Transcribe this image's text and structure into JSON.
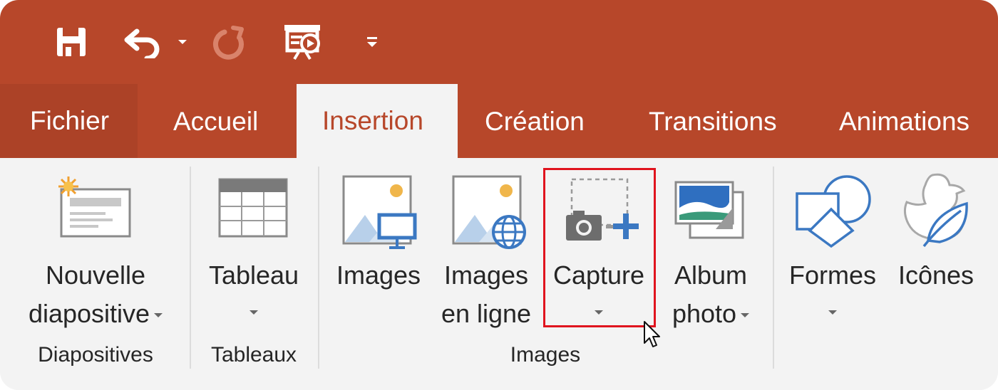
{
  "qat": {
    "save_icon": "save-icon",
    "undo_icon": "undo-icon",
    "redo_icon": "redo-icon",
    "present_icon": "present-from-start-icon",
    "customize_icon": "customize-qat-icon"
  },
  "tabs": [
    {
      "label": "Fichier"
    },
    {
      "label": "Accueil"
    },
    {
      "label": "Insertion"
    },
    {
      "label": "Création"
    },
    {
      "label": "Transitions"
    },
    {
      "label": "Animations"
    }
  ],
  "ribbon": {
    "new_slide": {
      "line1": "Nouvelle",
      "line2": "diapositive"
    },
    "table": {
      "line1": "Tableau"
    },
    "images": {
      "line1": "Images"
    },
    "online_images": {
      "line1": "Images",
      "line2": "en ligne"
    },
    "capture": {
      "line1": "Capture"
    },
    "album": {
      "line1": "Album",
      "line2": "photo"
    },
    "shapes": {
      "line1": "Formes"
    },
    "icons": {
      "line1": "Icônes"
    }
  },
  "groups": {
    "slides": "Diapositives",
    "tables": "Tableaux",
    "images": "Images"
  },
  "colors": {
    "brand": "#b7472a",
    "highlight": "#e0141e",
    "accent_blue": "#3b78c2"
  }
}
